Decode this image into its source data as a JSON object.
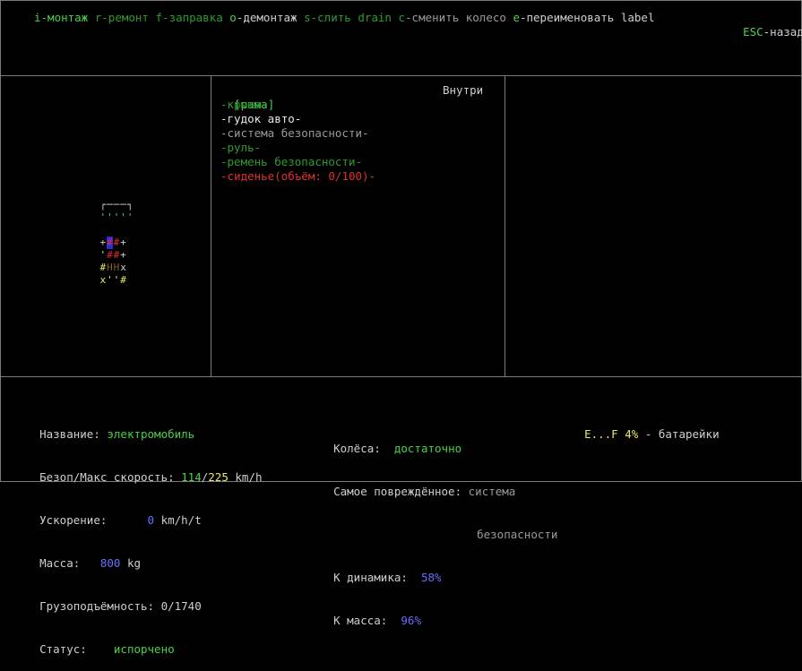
{
  "hotkeys": [
    {
      "key": "i",
      "label": "-монтаж",
      "key_color": "#4bd14b",
      "label_color": "#4bd14b"
    },
    {
      "key": "r",
      "label": "-ремонт",
      "key_color": "#2f9a2f",
      "label_color": "#2f9a2f"
    },
    {
      "key": "f",
      "label": "-заправка",
      "key_color": "#2f9a2f",
      "label_color": "#2f9a2f"
    },
    {
      "key": "o",
      "label": "-демонтаж",
      "key_color": "#4bd14b",
      "label_color": "#cfcfcf"
    },
    {
      "key": "s",
      "label": "-слить",
      "key_color": "#2f9a2f",
      "label_color": "#2f9a2f"
    },
    {
      "key": "drain",
      "label": "",
      "key_color": "#2f9a2f",
      "label_color": "#2f9a2f"
    },
    {
      "key": "c",
      "label": "-сменить колесо",
      "key_color": "#2f9a2f",
      "label_color": "#9a9a9a"
    },
    {
      "key": "e",
      "label": "-переименовать",
      "key_color": "#4bd14b",
      "label_color": "#cfcfcf"
    },
    {
      "key": "label",
      "label": "",
      "key_color": "#cfcfcf",
      "label_color": "#cfcfcf"
    }
  ],
  "escape": {
    "key": "ESC",
    "label": "-назад"
  },
  "parts_panel": {
    "selected": "[рама]",
    "location": "Внутри",
    "items": [
      {
        "text": "-крыша-",
        "color": "#2f9a2f"
      },
      {
        "text": "-гудок авто-",
        "color": "#e8e8e8"
      },
      {
        "text": "-система безопасности-",
        "color": "#9a9a9a"
      },
      {
        "text": "-руль-",
        "color": "#2f9a2f"
      },
      {
        "text": "-ремень безопасности-",
        "color": "#2f9a2f"
      },
      {
        "text": "-сиденье(объём: 0/100)-",
        "color": "#e03030"
      }
    ]
  },
  "vehicle_glyphs": [
    [
      {
        "ch": "┌",
        "c": "#cfcfcf"
      },
      {
        "ch": "─",
        "c": "#cfcfcf"
      },
      {
        "ch": "─",
        "c": "#cfcfcf"
      },
      {
        "ch": "─",
        "c": "#cfcfcf"
      },
      {
        "ch": "┐",
        "c": "#cfcfcf"
      }
    ],
    [
      {
        "ch": "'",
        "c": "#58c8e8"
      },
      {
        "ch": "'",
        "c": "#58c8e8"
      },
      {
        "ch": "'",
        "c": "#58c8e8"
      },
      {
        "ch": "'",
        "c": "#58c8e8"
      },
      {
        "ch": "'",
        "c": "#58c8e8"
      }
    ],
    [
      {
        "ch": " ",
        "c": "#000"
      }
    ],
    [
      {
        "ch": "+",
        "c": "#cfcfcf"
      },
      {
        "ch": "#",
        "c": "#e03030",
        "bg": "#2a2ad8"
      },
      {
        "ch": "#",
        "c": "#e03030"
      },
      {
        "ch": "+",
        "c": "#cfcfcf"
      }
    ],
    [
      {
        "ch": "'",
        "c": "#e8e86a"
      },
      {
        "ch": "#",
        "c": "#e03030"
      },
      {
        "ch": "#",
        "c": "#e03030"
      },
      {
        "ch": "+",
        "c": "#cfcfcf"
      }
    ],
    [
      {
        "ch": "#",
        "c": "#e8e86a"
      },
      {
        "ch": "H",
        "c": "#8a5a2a"
      },
      {
        "ch": "H",
        "c": "#8a5a2a"
      },
      {
        "ch": "x",
        "c": "#cfcfcf"
      }
    ],
    [
      {
        "ch": "x",
        "c": "#e8e86a"
      },
      {
        "ch": "'",
        "c": "#e8e86a"
      },
      {
        "ch": "'",
        "c": "#e8e86a"
      },
      {
        "ch": "#",
        "c": "#e8e86a"
      }
    ]
  ],
  "stats_left": [
    {
      "label": "Название:",
      "value": "электромобиль",
      "value_color": "#4bd14b"
    },
    {
      "label": "Безоп/Макс скорость:",
      "value_a": "114",
      "sep": "/",
      "value_b": "225",
      "unit": "km/h"
    },
    {
      "label": "Ускорение:",
      "value": "0",
      "unit": "km/h/t"
    },
    {
      "label": "Масса:",
      "value": "800",
      "unit": "kg"
    },
    {
      "label": "Грузоподъёмность:",
      "value": "0/1740"
    },
    {
      "label": "Статус:",
      "value": "испорчено",
      "value_color": "#4bd14b"
    }
  ],
  "stats_right": {
    "wheels_label": "Колёса:",
    "wheels_value": "достаточно",
    "damaged_label": "Самое повреждённое:",
    "damaged_value_1": "система",
    "damaged_value_2": "безопасности",
    "fuel_range": "E...F",
    "fuel_pct": "4%",
    "fuel_label": "- батарейки",
    "k_dyn_label": "К динамика:",
    "k_dyn_value": "58%",
    "k_mass_label": "К масса:",
    "k_mass_value": "96%"
  }
}
